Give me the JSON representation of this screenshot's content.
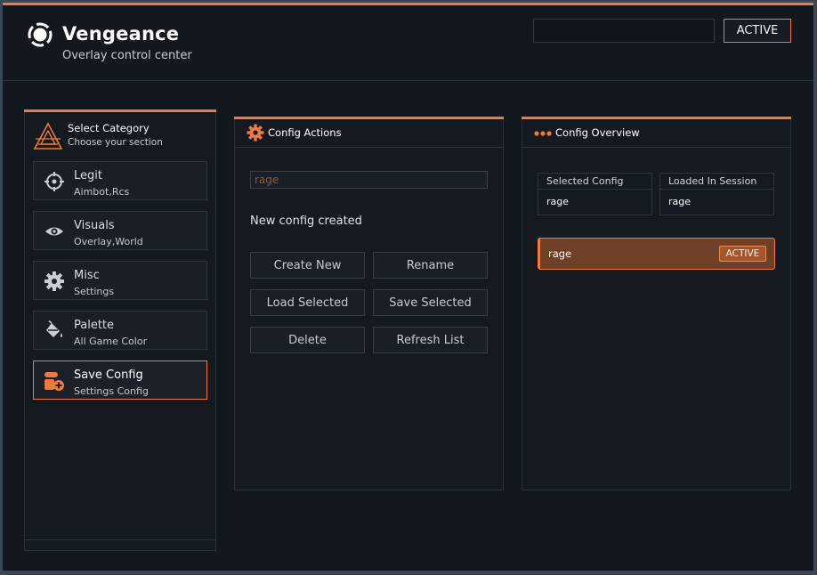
{
  "header": {
    "title": "Vengeance",
    "subtitle": "Overlay control center",
    "search_value": "",
    "status_label": "ACTIVE"
  },
  "sidebar": {
    "title": "Select Category",
    "subtitle": "Choose your section",
    "items": [
      {
        "label": "Legit",
        "sub": "Aimbot,Rcs",
        "icon": "crosshair-icon"
      },
      {
        "label": "Visuals",
        "sub": "Overlay,World",
        "icon": "eye-icon"
      },
      {
        "label": "Misc",
        "sub": "Settings",
        "icon": "gear-icon"
      },
      {
        "label": "Palette",
        "sub": "All Game Color",
        "icon": "paint-bucket-icon"
      },
      {
        "label": "Save Config",
        "sub": "Settings Config",
        "icon": "save-config-icon",
        "selected": true
      }
    ]
  },
  "actions": {
    "title": "Config Actions",
    "input_placeholder": "rage",
    "status": "New config created",
    "buttons": {
      "create_new": "Create New",
      "rename": "Rename",
      "load_selected": "Load Selected",
      "save_selected": "Save Selected",
      "delete": "Delete",
      "refresh_list": "Refresh List"
    }
  },
  "overview": {
    "title": "Config Overview",
    "selected_label": "Selected Config",
    "selected_value": "rage",
    "loaded_label": "Loaded In Session",
    "loaded_value": "rage",
    "configs": [
      {
        "name": "rage",
        "badge": "ACTIVE"
      }
    ]
  },
  "colors": {
    "accent": "#f07a3a",
    "background": "#13171e",
    "panel": "#151a21",
    "active_row": "#6e4027"
  }
}
